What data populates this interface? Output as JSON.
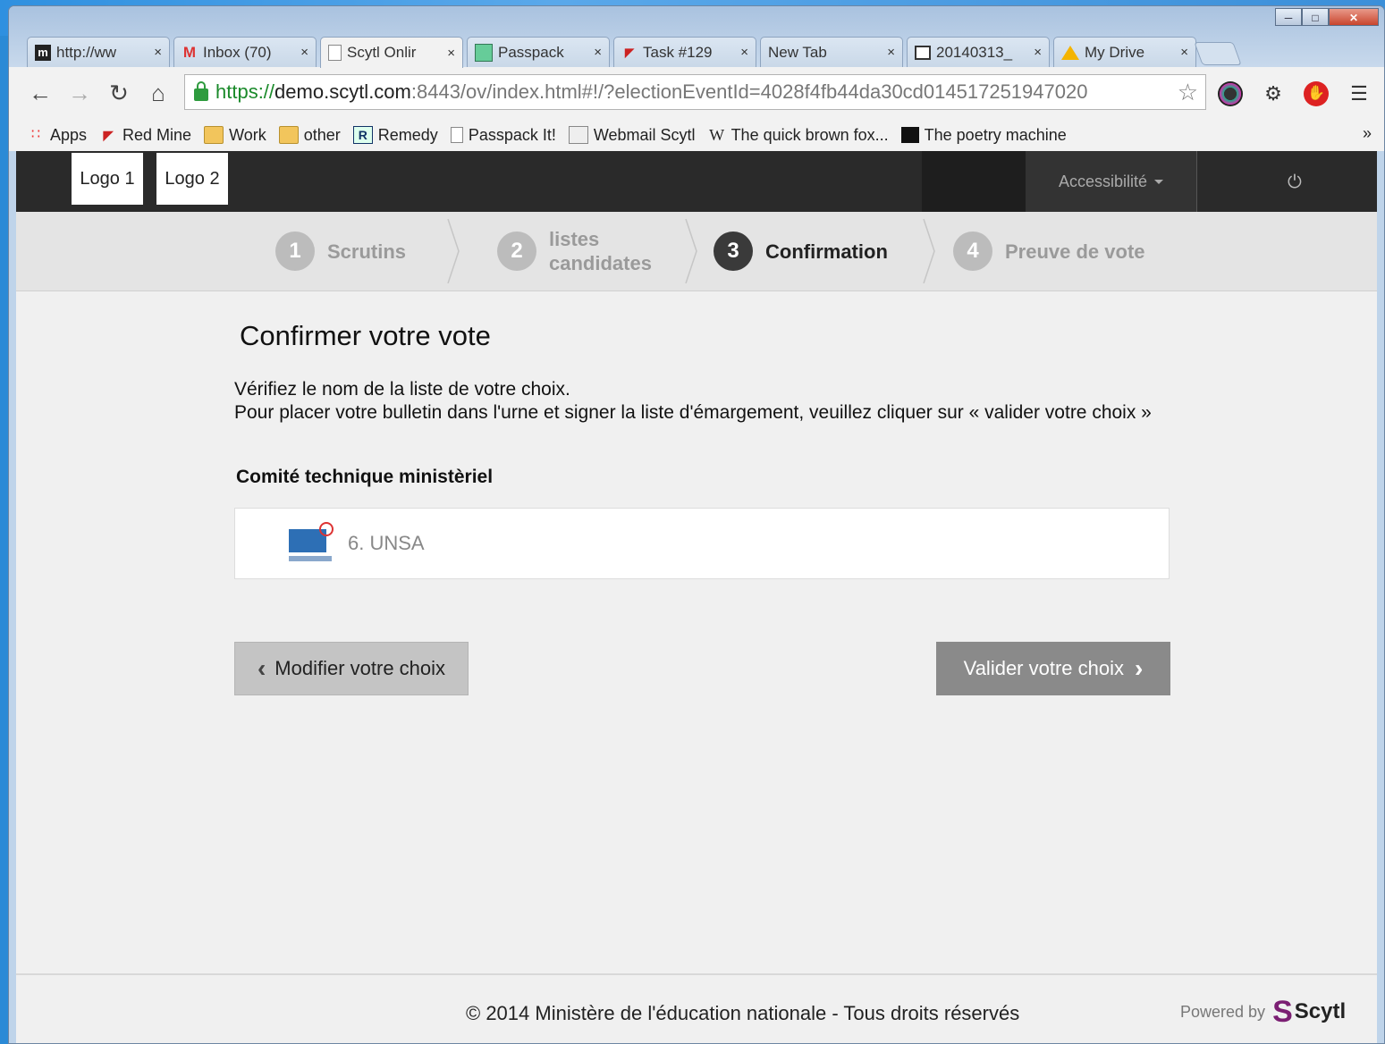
{
  "browser": {
    "tabs": [
      {
        "icon": "newspaper-icon",
        "title": "http://ww"
      },
      {
        "icon": "gmail-icon",
        "title": "Inbox (70)"
      },
      {
        "icon": "page-icon",
        "title": "Scytl Onlir"
      },
      {
        "icon": "passpack-icon",
        "title": "Passpack"
      },
      {
        "icon": "redmine-icon",
        "title": "Task #129"
      },
      {
        "icon": "",
        "title": "New Tab"
      },
      {
        "icon": "image-icon",
        "title": "20140313_"
      },
      {
        "icon": "drive-icon",
        "title": "My Drive"
      }
    ],
    "close_glyph": "×",
    "url": {
      "scheme": "https://",
      "host": "demo.scytl.com",
      "rest": ":8443/ov/index.html#!/?electionEventId=4028f4fb44da30cd014517251947020"
    },
    "bookmarks": [
      "Apps",
      "Red Mine",
      "Work",
      "other",
      "Remedy",
      "Passpack It!",
      "Webmail Scytl",
      "The quick brown fox...",
      "The poetry machine"
    ],
    "overflow": "»"
  },
  "header": {
    "logo1": "Logo 1",
    "logo2": "Logo 2",
    "accessibility": "Accessibilité"
  },
  "steps": [
    {
      "num": "1",
      "label": "Scrutins"
    },
    {
      "num": "2",
      "label_line1": "listes",
      "label_line2": "candidates"
    },
    {
      "num": "3",
      "label": "Confirmation"
    },
    {
      "num": "4",
      "label": "Preuve de vote"
    }
  ],
  "main": {
    "title": "Confirmer votre vote",
    "instruction1": "Vérifiez le nom de la liste de votre choix.",
    "instruction2": "Pour placer votre bulletin dans l'urne et signer la liste d'émargement, veuillez cliquer sur « valider votre choix »",
    "section": "Comité technique ministèriel",
    "choice": "6. UNSA",
    "modify_button": "Modifier votre choix",
    "validate_button": "Valider votre choix"
  },
  "footer": {
    "copyright": "© 2014 Ministère de l'éducation nationale - Tous droits réservés",
    "powered_by": "Powered by",
    "brand": "Scytl"
  },
  "colors": {
    "header_bg": "#2a2a2a",
    "active_step": "#3a3a3a",
    "validate_button": "#8a8a8a",
    "brand": "#7b1f73"
  }
}
